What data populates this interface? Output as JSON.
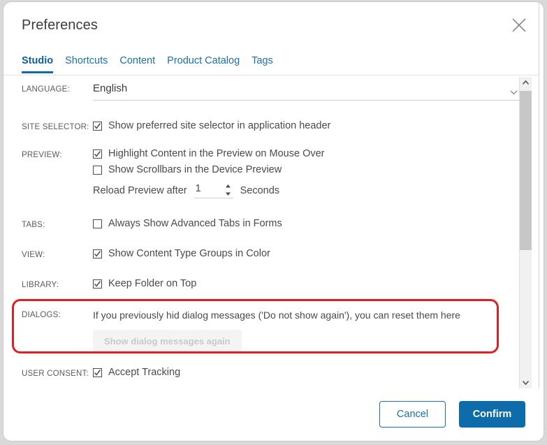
{
  "dialog": {
    "title": "Preferences",
    "close_icon": "close-icon"
  },
  "tabs": [
    {
      "label": "Studio",
      "active": true
    },
    {
      "label": "Shortcuts",
      "active": false
    },
    {
      "label": "Content",
      "active": false
    },
    {
      "label": "Product Catalog",
      "active": false
    },
    {
      "label": "Tags",
      "active": false
    }
  ],
  "settings": {
    "language": {
      "label": "LANGUAGE:",
      "value": "English",
      "icon": "chevron-down-icon"
    },
    "site_selector": {
      "label": "SITE SELECTOR:",
      "option": "Show preferred site selector in application header",
      "checked": true
    },
    "preview": {
      "label": "PREVIEW:",
      "option1": "Highlight Content in the Preview on Mouse Over",
      "option1_checked": true,
      "option2": "Show Scrollbars in the Device Preview",
      "option2_checked": false,
      "reload_prefix": "Reload Preview after",
      "reload_value": "1",
      "reload_suffix": "Seconds"
    },
    "tabs_section": {
      "label": "TABS:",
      "option": "Always Show Advanced Tabs in Forms",
      "checked": false
    },
    "view": {
      "label": "VIEW:",
      "option": "Show Content Type Groups in Color",
      "checked": true
    },
    "library": {
      "label": "LIBRARY:",
      "option": "Keep Folder on Top",
      "checked": true
    },
    "dialogs": {
      "label": "DIALOGS:",
      "note": "If you previously hid dialog messages ('Do not show again'), you can reset them here",
      "button_label": "Show dialog messages again",
      "button_disabled": true
    },
    "user_consent": {
      "label": "USER CONSENT:",
      "option": "Accept Tracking",
      "checked": true
    }
  },
  "annotation": {
    "color": "#e02020",
    "target": "dialogs-row"
  },
  "scrollbar": {
    "up_icon": "chevron-up-icon",
    "down_icon": "chevron-down-icon"
  },
  "footer": {
    "cancel_label": "Cancel",
    "confirm_label": "Confirm"
  },
  "colors": {
    "accent": "#0d6ca9",
    "link": "#1a6fae",
    "annotation": "#e02020",
    "text": "#4a4a4a"
  }
}
